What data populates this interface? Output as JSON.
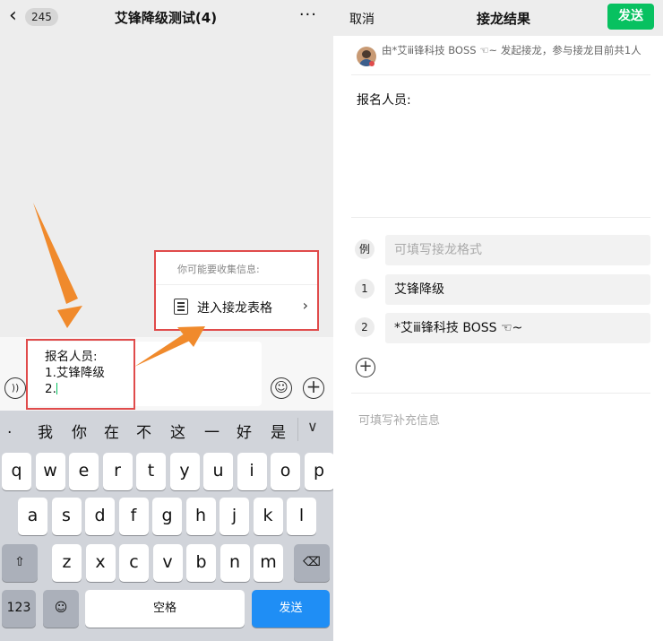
{
  "chat_header": {
    "back_glyph": "‹",
    "badge": "245",
    "title": "艾锋降级测试(4)",
    "more_glyph": "···"
  },
  "popup": {
    "hint": "你可能要收集信息:",
    "action_label": "进入接龙表格",
    "chevron": "›"
  },
  "message_input": {
    "lines": "报名人员:\n1.艾锋降级\n2."
  },
  "keyboard": {
    "suggestions": [
      ".",
      "我",
      "你",
      "在",
      "不",
      "这",
      "一",
      "好",
      "是"
    ],
    "row1": [
      "q",
      "w",
      "e",
      "r",
      "t",
      "y",
      "u",
      "i",
      "o",
      "p"
    ],
    "row2": [
      "a",
      "s",
      "d",
      "f",
      "g",
      "h",
      "j",
      "k",
      "l"
    ],
    "row3": [
      "z",
      "x",
      "c",
      "v",
      "b",
      "n",
      "m"
    ],
    "shift_glyph": "⇧",
    "delete_glyph": "⌫",
    "numbers_label": "123",
    "emoji_glyph": "☺",
    "space_label": "空格",
    "send_label": "发送",
    "collapse_glyph": "∨"
  },
  "icons": {
    "voice": "voice-icon",
    "emoji": "emoji-icon",
    "plus": "plus-icon"
  },
  "solitaire": {
    "cancel_label": "取消",
    "title": "接龙结果",
    "send_label": "发送",
    "started_text": "由*艾ⅲ锋科技 BOSS ☜~ 发起接龙，参与接龙目前共1人",
    "body_heading": "报名人员:",
    "example_badge": "例",
    "example_placeholder": "可填写接龙格式",
    "entries": [
      {
        "num": "1",
        "text": "艾锋降级"
      },
      {
        "num": "2",
        "text": "*艾ⅲ锋科技 BOSS ☜~"
      }
    ],
    "add_glyph": "+",
    "supplement_placeholder": "可填写补充信息"
  },
  "colors": {
    "wechat_green": "#07c160",
    "highlight_red": "#e04b4b",
    "arrow_orange": "#f08a2c",
    "ios_blue": "#1f8ef5"
  }
}
